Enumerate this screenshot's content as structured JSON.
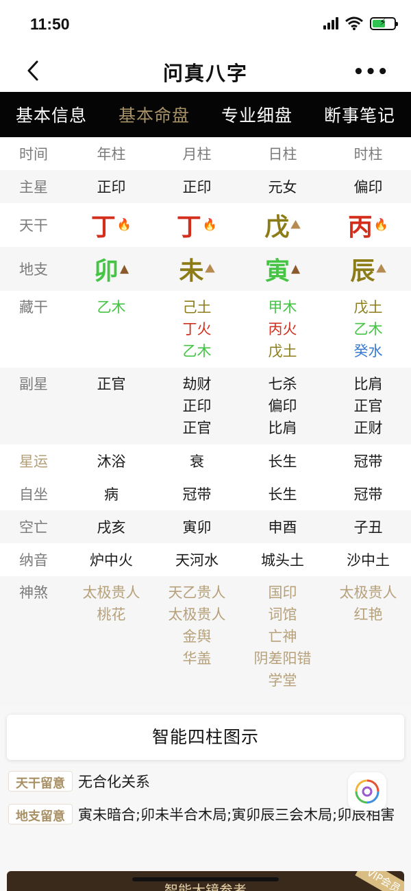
{
  "status": {
    "time": "11:50"
  },
  "nav": {
    "title": "问真八字",
    "more": "•••"
  },
  "tabs": [
    {
      "label": "基本信息",
      "active": false
    },
    {
      "label": "基本命盘",
      "active": true
    },
    {
      "label": "专业细盘",
      "active": false
    },
    {
      "label": "断事笔记",
      "active": false
    }
  ],
  "header_row": {
    "label": "时间",
    "cols": [
      "年柱",
      "月柱",
      "日柱",
      "时柱"
    ]
  },
  "main_star": {
    "label": "主星",
    "cols": [
      "正印",
      "正印",
      "元女",
      "偏印"
    ]
  },
  "tiangan": {
    "label": "天干",
    "chars": [
      "丁",
      "丁",
      "戊",
      "丙"
    ],
    "elements": [
      "fire-icon",
      "fire-icon",
      "earth-icon",
      "fire-icon"
    ]
  },
  "dizhi": {
    "label": "地支",
    "chars": [
      "卯",
      "未",
      "寅",
      "辰"
    ],
    "elements": [
      "wood-icon",
      "earth-icon",
      "wood-icon",
      "earth-icon"
    ]
  },
  "canggan": {
    "label": "藏干",
    "cols": [
      [
        "乙木"
      ],
      [
        "己土",
        "丁火",
        "乙木"
      ],
      [
        "甲木",
        "丙火",
        "戊土"
      ],
      [
        "戊土",
        "乙木",
        "癸水"
      ]
    ]
  },
  "fuxing": {
    "label": "副星",
    "cols": [
      [
        "正官"
      ],
      [
        "劫财",
        "正印",
        "正官"
      ],
      [
        "七杀",
        "偏印",
        "比肩"
      ],
      [
        "比肩",
        "正官",
        "正财"
      ]
    ]
  },
  "xingyun": {
    "label": "星运",
    "cols": [
      "沐浴",
      "衰",
      "长生",
      "冠带"
    ]
  },
  "zizuo": {
    "label": "自坐",
    "cols": [
      "病",
      "冠带",
      "长生",
      "冠带"
    ]
  },
  "kongwang": {
    "label": "空亡",
    "cols": [
      "戌亥",
      "寅卯",
      "申酉",
      "子丑"
    ]
  },
  "nayin": {
    "label": "纳音",
    "cols": [
      "炉中火",
      "天河水",
      "城头土",
      "沙中土"
    ]
  },
  "shensha": {
    "label": "神煞",
    "cols": [
      [
        "太极贵人",
        "桃花"
      ],
      [
        "天乙贵人",
        "太极贵人",
        "金舆",
        "华盖"
      ],
      [
        "国印",
        "词馆",
        "亡神",
        "阴差阳错",
        "学堂"
      ],
      [
        "太极贵人",
        "红艳"
      ]
    ]
  },
  "smart_chart_button": "智能四柱图示",
  "notes": [
    {
      "tag": "天干留意",
      "text": "无合化关系"
    },
    {
      "tag": "地支留意",
      "text": "寅未暗合;卯未半合木局;寅卯辰三会木局;卯辰相害"
    }
  ],
  "banner": {
    "text": "智能大镜参考",
    "vip": "VIP会员"
  },
  "colors": {
    "accent": "#a79267",
    "tab_bg": "#050505",
    "wood": "#45c445",
    "earth": "#8c7c18",
    "fire": "#d22e1b",
    "water": "#3a7bd2"
  }
}
